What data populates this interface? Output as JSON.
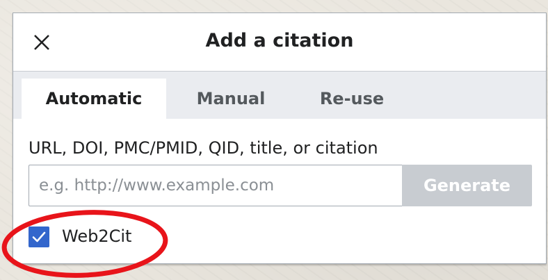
{
  "dialog": {
    "title": "Add a citation",
    "close_icon": "close-icon"
  },
  "tabs": [
    {
      "label": "Automatic",
      "active": true
    },
    {
      "label": "Manual",
      "active": false
    },
    {
      "label": "Re-use",
      "active": false
    }
  ],
  "form": {
    "field_label": "URL, DOI, PMC/PMID, QID, title, or citation",
    "input_value": "",
    "input_placeholder": "e.g. http://www.example.com",
    "generate_label": "Generate",
    "generate_enabled": false
  },
  "option": {
    "checkbox_label": "Web2Cit",
    "checked": true
  },
  "colors": {
    "accent": "#3366cc",
    "annotation": "#e8141a",
    "disabled_button": "#c8ccd1"
  }
}
